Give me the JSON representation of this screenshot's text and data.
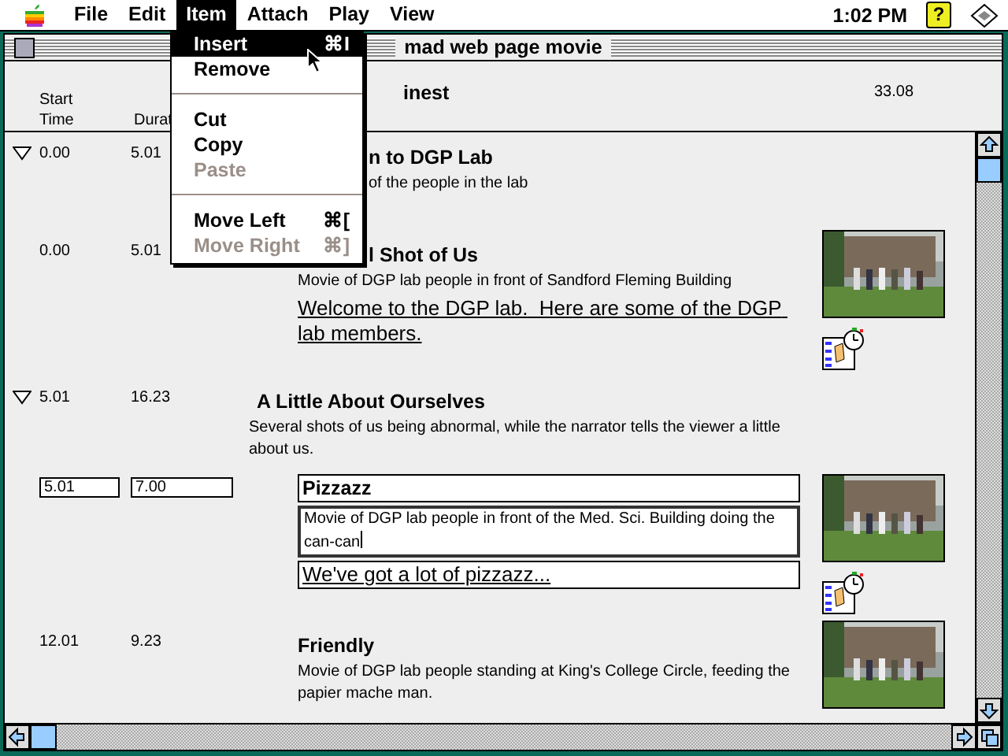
{
  "menubar": {
    "items": [
      {
        "label": "File",
        "selected": false
      },
      {
        "label": "Edit",
        "selected": false
      },
      {
        "label": "Item",
        "selected": true
      },
      {
        "label": "Attach",
        "selected": false
      },
      {
        "label": "Play",
        "selected": false
      },
      {
        "label": "View",
        "selected": false
      }
    ],
    "clock": "1:02 PM",
    "help_glyph": "?"
  },
  "menu": {
    "items": [
      {
        "kind": "item",
        "label": "Insert",
        "shortcut": "⌘I",
        "highlighted": true,
        "disabled": false
      },
      {
        "kind": "item",
        "label": "Remove",
        "highlighted": false,
        "disabled": false
      },
      {
        "kind": "separator"
      },
      {
        "kind": "item",
        "label": "Cut",
        "highlighted": false,
        "disabled": false
      },
      {
        "kind": "item",
        "label": "Copy",
        "highlighted": false,
        "disabled": false
      },
      {
        "kind": "item",
        "label": "Paste",
        "highlighted": false,
        "disabled": true
      },
      {
        "kind": "separator"
      },
      {
        "kind": "item",
        "label": "Move Left",
        "shortcut": "⌘[",
        "highlighted": false,
        "disabled": false
      },
      {
        "kind": "item",
        "label": "Move Right",
        "shortcut": "⌘]",
        "highlighted": false,
        "disabled": true
      }
    ]
  },
  "window": {
    "title": "mad web page movie"
  },
  "header": {
    "start_label": [
      "Start",
      "Time"
    ],
    "duration_label": "Durat",
    "title": "inest",
    "total": "33.08"
  },
  "rows": [
    {
      "start": "0.00",
      "duration": "5.01",
      "expanded": true,
      "title": "n to DGP Lab",
      "title_cut": true,
      "description": "of the people in the lab",
      "description_cut": true,
      "children": [
        {
          "start": "0.00",
          "duration": "5.01",
          "title": "l Shot of Us",
          "title_cut": true,
          "description": "Movie of DGP lab people in front of Sandford Fleming Building",
          "link": "Welcome to the DGP lab.  Here are some of the DGP lab members.",
          "attachment": true
        }
      ]
    },
    {
      "start": "5.01",
      "duration": "16.23",
      "expanded": true,
      "title": "A Little About Ourselves",
      "description": "Several shots of us being abnormal, while the narrator tells the viewer a little about us.",
      "children": [
        {
          "start": "5.01",
          "duration": "7.00",
          "editing": true,
          "title": "Pizzazz",
          "description": "Movie of DGP lab people in front of the Med. Sci. Building doing the can-can",
          "link": "We've got a lot of pizzazz...",
          "attachment": true
        },
        {
          "start": "12.01",
          "duration": "9.23",
          "title": "Friendly",
          "description": "Movie of DGP lab people standing at King's College Circle, feeding the papier mache man."
        }
      ]
    }
  ]
}
